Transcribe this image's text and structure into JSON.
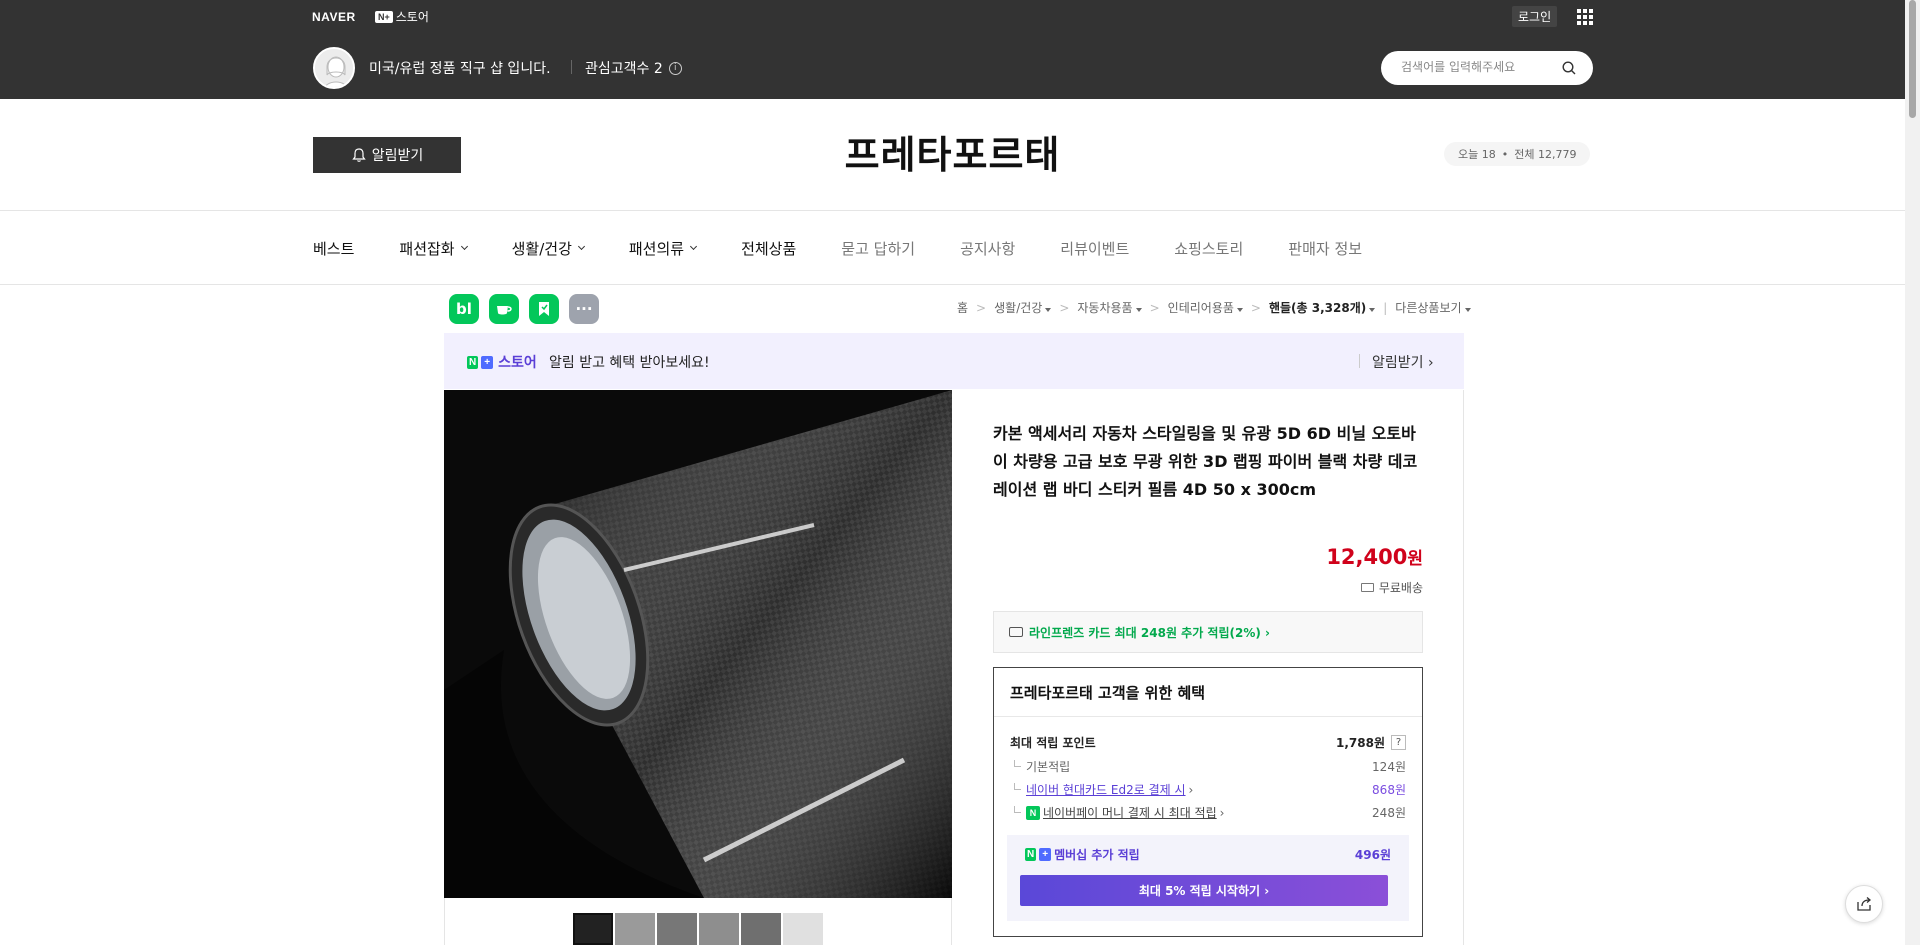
{
  "topbar": {
    "naver_logo": "NAVER",
    "nplus_badge": "N+",
    "nplus_store": "스토어",
    "login": "로그인",
    "store_desc": "미국/유럽 정품 직구 샵 입니다.",
    "followers": "관심고객수 2",
    "search_placeholder": "검색어를 입력해주세요"
  },
  "header": {
    "alarm_button": "알림받기",
    "store_title": "프레타포르태",
    "today": "오늘 18",
    "total": "전체 12,779"
  },
  "nav": {
    "items": [
      {
        "label": "베스트",
        "dropdown": false
      },
      {
        "label": "패션잡화",
        "dropdown": true
      },
      {
        "label": "생활/건강",
        "dropdown": true
      },
      {
        "label": "패션의류",
        "dropdown": true
      },
      {
        "label": "전체상품",
        "dropdown": false
      },
      {
        "label": "묻고 답하기",
        "dropdown": false
      },
      {
        "label": "공지사항",
        "dropdown": false
      },
      {
        "label": "리뷰이벤트",
        "dropdown": false
      },
      {
        "label": "쇼핑스토리",
        "dropdown": false
      },
      {
        "label": "판매자 정보",
        "dropdown": false
      }
    ]
  },
  "share": {
    "blog": "bl",
    "more": "···"
  },
  "breadcrumb": {
    "items": [
      "홈",
      "생활/건강",
      "자동차용품",
      "인테리어용품"
    ],
    "current": "핸들(총 3,328개)",
    "other": "다른상품보기"
  },
  "banner": {
    "badge_n": "N",
    "badge_plus": "+",
    "store": "스토어",
    "text": "알림 받고 혜택 받아보세요!",
    "link": "알림받기 ›"
  },
  "product": {
    "title": "카본 액세서리 자동차 스타일링을 및 유광 5D 6D 비닐 오토바이 차량용 고급 보호 무광 위한 3D 랩핑 파이버 블랙 차량 데코레이션 랩 바디 스티커 필름 4D 50 x 300cm",
    "price": "12,400",
    "price_unit": "원",
    "shipping": "무료배송",
    "card_benefit": "라인프렌즈 카드 최대 248원 추가 적립(2%) ›"
  },
  "benefit": {
    "title": "프레타포르태 고객을 위한 혜택",
    "max_points_label": "최대 적립 포인트",
    "max_points_value": "1,788원",
    "help": "?",
    "basic_label": "기본적립",
    "basic_value": "124원",
    "card_label": "네이버 현대카드 Ed2로 결제 시",
    "card_value": "868원",
    "pay_label": "네이버페이 머니 결제 시 최대 적립",
    "pay_value": "248원",
    "membership_label": "멤버십 추가 적립",
    "membership_value": "496원",
    "membership_button": "최대 5% 적립 시작하기 ›"
  },
  "colors": {
    "topbar": "#333333",
    "price": "#d0021b",
    "naver_green": "#03c75a",
    "purple": "#5a3fd6"
  }
}
